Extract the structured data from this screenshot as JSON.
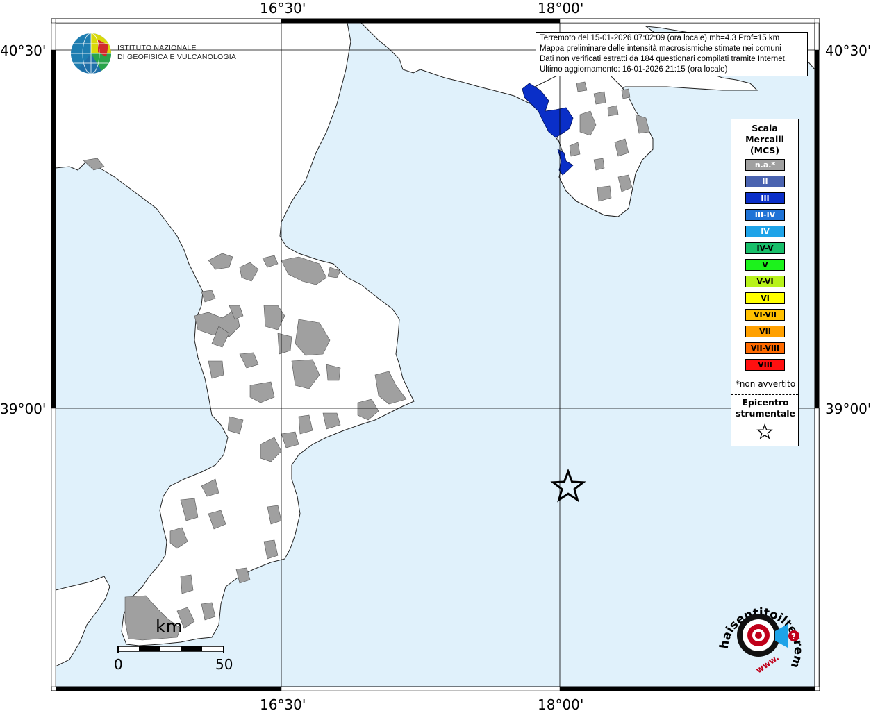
{
  "ticks": {
    "lon": [
      "16°30'",
      "18°00'"
    ],
    "lat": [
      "40°30'",
      "39°00'"
    ]
  },
  "info": {
    "line1": "Terremoto del 15-01-2026 07:02:09 (ora locale) mb=4.3 Prof=15 km",
    "line2": "Mappa preliminare delle intensità macrosismiche stimate nei comuni",
    "line3": "Dati non verificati estratti da 184 questionari compilati tramite Internet.",
    "line4": "Ultimo aggiornamento: 16-01-2026 21:15 (ora locale)"
  },
  "logo": {
    "line1": "ISTITUTO NAZIONALE",
    "line2": "DI GEOFISICA E VULCANOLOGIA"
  },
  "legend": {
    "title1": "Scala",
    "title2": "Mercalli",
    "title3": "(MCS)",
    "items": [
      {
        "label": "n.a.*",
        "color": "#a0a0a0",
        "text_color": "#ffffff"
      },
      {
        "label": "II",
        "color": "#4a63b0",
        "text_color": "#ffffff"
      },
      {
        "label": "III",
        "color": "#0a2fc8",
        "text_color": "#ffffff"
      },
      {
        "label": "III-IV",
        "color": "#1f73d6",
        "text_color": "#ffffff"
      },
      {
        "label": "IV",
        "color": "#1ea3e8",
        "text_color": "#ffffff"
      },
      {
        "label": "IV-V",
        "color": "#18bf6a",
        "text_color": "#000000"
      },
      {
        "label": "V",
        "color": "#1cf21c",
        "text_color": "#000000"
      },
      {
        "label": "V-VI",
        "color": "#b7f21a",
        "text_color": "#000000"
      },
      {
        "label": "VI",
        "color": "#ffff00",
        "text_color": "#000000"
      },
      {
        "label": "VI-VII",
        "color": "#ffc000",
        "text_color": "#000000"
      },
      {
        "label": "VII",
        "color": "#ffa000",
        "text_color": "#000000"
      },
      {
        "label": "VII-VIII",
        "color": "#ff6a00",
        "text_color": "#000000"
      },
      {
        "label": "VIII",
        "color": "#ff1010",
        "text_color": "#000000"
      }
    ],
    "note": "*non avvertito",
    "epi1": "Epicentro",
    "epi2": "strumentale"
  },
  "scale": {
    "unit": "km",
    "min": "0",
    "max": "50"
  },
  "watermark": {
    "text": "haisentitoilterremoto.it",
    "prefix": "www."
  },
  "colors": {
    "sea": "#e0f1fb",
    "land": "#ffffff",
    "na_gray": "#a0a0a0",
    "intensity_III": "#0a2fc8",
    "grid": "#000000"
  }
}
